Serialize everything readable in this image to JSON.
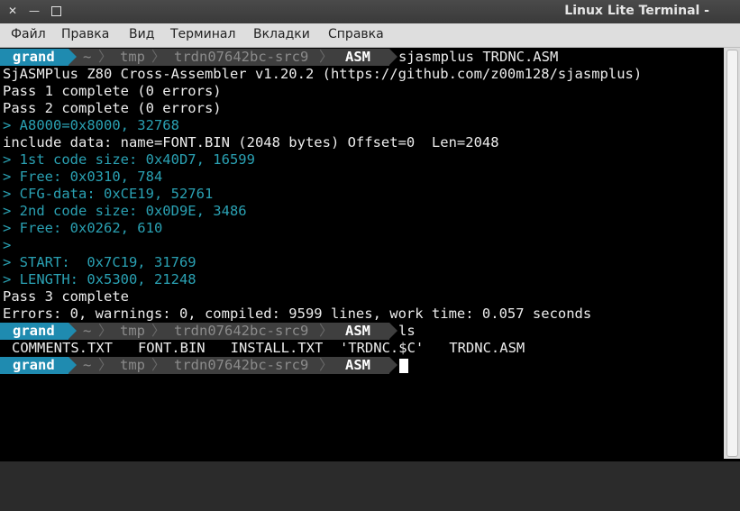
{
  "window": {
    "title": "Linux Lite Terminal -"
  },
  "menu": [
    "Файл",
    "Правка",
    "Вид",
    "Терминал",
    "Вкладки",
    "Справка"
  ],
  "prompt": {
    "user": "grand",
    "home": "~",
    "dir1": "tmp",
    "dir2": "trdn07642bc-src9",
    "cwd": "ASM",
    "sep": "〉"
  },
  "commands": {
    "first": "sjasmplus TRDNC.ASM",
    "second": "ls"
  },
  "output": [
    {
      "text": "SjASMPlus Z80 Cross-Assembler v1.20.2 (https://github.com/z00m128/sjasmplus)",
      "cyan": false
    },
    {
      "text": "Pass 1 complete (0 errors)",
      "cyan": false
    },
    {
      "text": "Pass 2 complete (0 errors)",
      "cyan": false
    },
    {
      "text": "> A8000=0x8000, 32768",
      "cyan": true
    },
    {
      "text": "include data: name=FONT.BIN (2048 bytes) Offset=0  Len=2048",
      "cyan": false
    },
    {
      "text": "> 1st code size: 0x40D7, 16599",
      "cyan": true
    },
    {
      "text": "> Free: 0x0310, 784",
      "cyan": true
    },
    {
      "text": "> CFG-data: 0xCE19, 52761",
      "cyan": true
    },
    {
      "text": "> 2nd code size: 0x0D9E, 3486",
      "cyan": true
    },
    {
      "text": "> Free: 0x0262, 610",
      "cyan": true
    },
    {
      "text": ">",
      "cyan": true
    },
    {
      "text": "> START:  0x7C19, 31769",
      "cyan": true
    },
    {
      "text": "> LENGTH: 0x5300, 21248",
      "cyan": true
    },
    {
      "text": "Pass 3 complete",
      "cyan": false
    },
    {
      "text": "Errors: 0, warnings: 0, compiled: 9599 lines, work time: 0.057 seconds",
      "cyan": false
    }
  ],
  "ls_output": "COMMENTS.TXT   FONT.BIN   INSTALL.TXT  'TRDNC.$C'   TRDNC.ASM",
  "colors": {
    "user_bg": "#1f8bb0",
    "path_bg": "#3f3f3f",
    "cyan_text": "#2aa1b3"
  }
}
